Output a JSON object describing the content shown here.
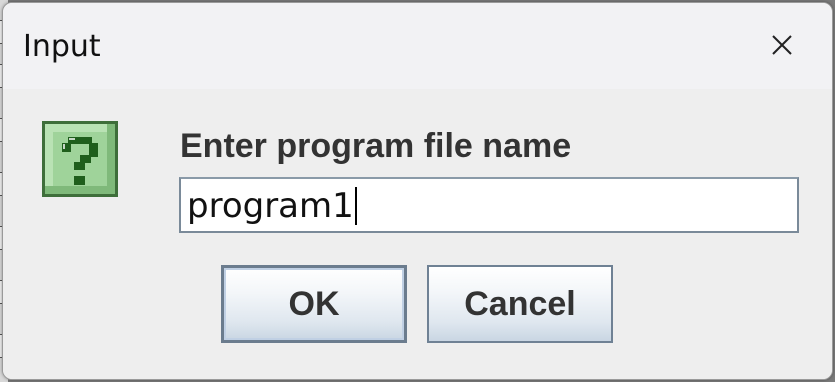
{
  "window": {
    "title": "Input",
    "close_icon": "close-icon"
  },
  "dialog": {
    "icon": "question-icon",
    "prompt": "Enter program file name",
    "input_value": "program1"
  },
  "buttons": {
    "ok_label": "OK",
    "cancel_label": "Cancel"
  },
  "colors": {
    "icon_fill": "#9fd39a",
    "icon_glyph": "#1f5e1c",
    "button_border": "#6f8194",
    "field_border": "#7a8a99"
  }
}
